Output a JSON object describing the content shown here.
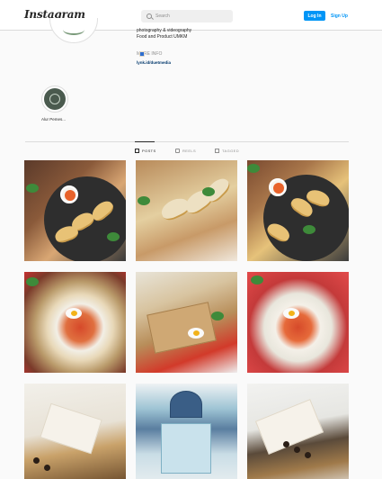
{
  "nav": {
    "logo": "Instagram",
    "search_placeholder": "Search",
    "login_label": "Log In",
    "signup_label": "Sign Up"
  },
  "profile": {
    "bio_line1": "photography & videography",
    "bio_line2": "Food and Product UMKM",
    "more_info": "MORE INFO",
    "link": "lynk.id/duetmedia"
  },
  "highlight": {
    "label": "Alur Pemes..."
  },
  "tabs": [
    {
      "label": "POSTS",
      "active": true
    },
    {
      "label": "REELS",
      "active": false
    },
    {
      "label": "TAGGED",
      "active": false
    }
  ],
  "posts": [
    {
      "subject": "gyoza-plate"
    },
    {
      "subject": "gyoza-board"
    },
    {
      "subject": "gyoza-plate-2"
    },
    {
      "subject": "rice-egg-plate"
    },
    {
      "subject": "rice-box"
    },
    {
      "subject": "rice-egg-plate-2"
    },
    {
      "subject": "snack-box"
    },
    {
      "subject": "gift-basket"
    },
    {
      "subject": "snack-box-2"
    }
  ],
  "colors": {
    "accent": "#0095f6",
    "text": "#262626",
    "muted": "#8e8e8e",
    "background": "#fafafa"
  }
}
